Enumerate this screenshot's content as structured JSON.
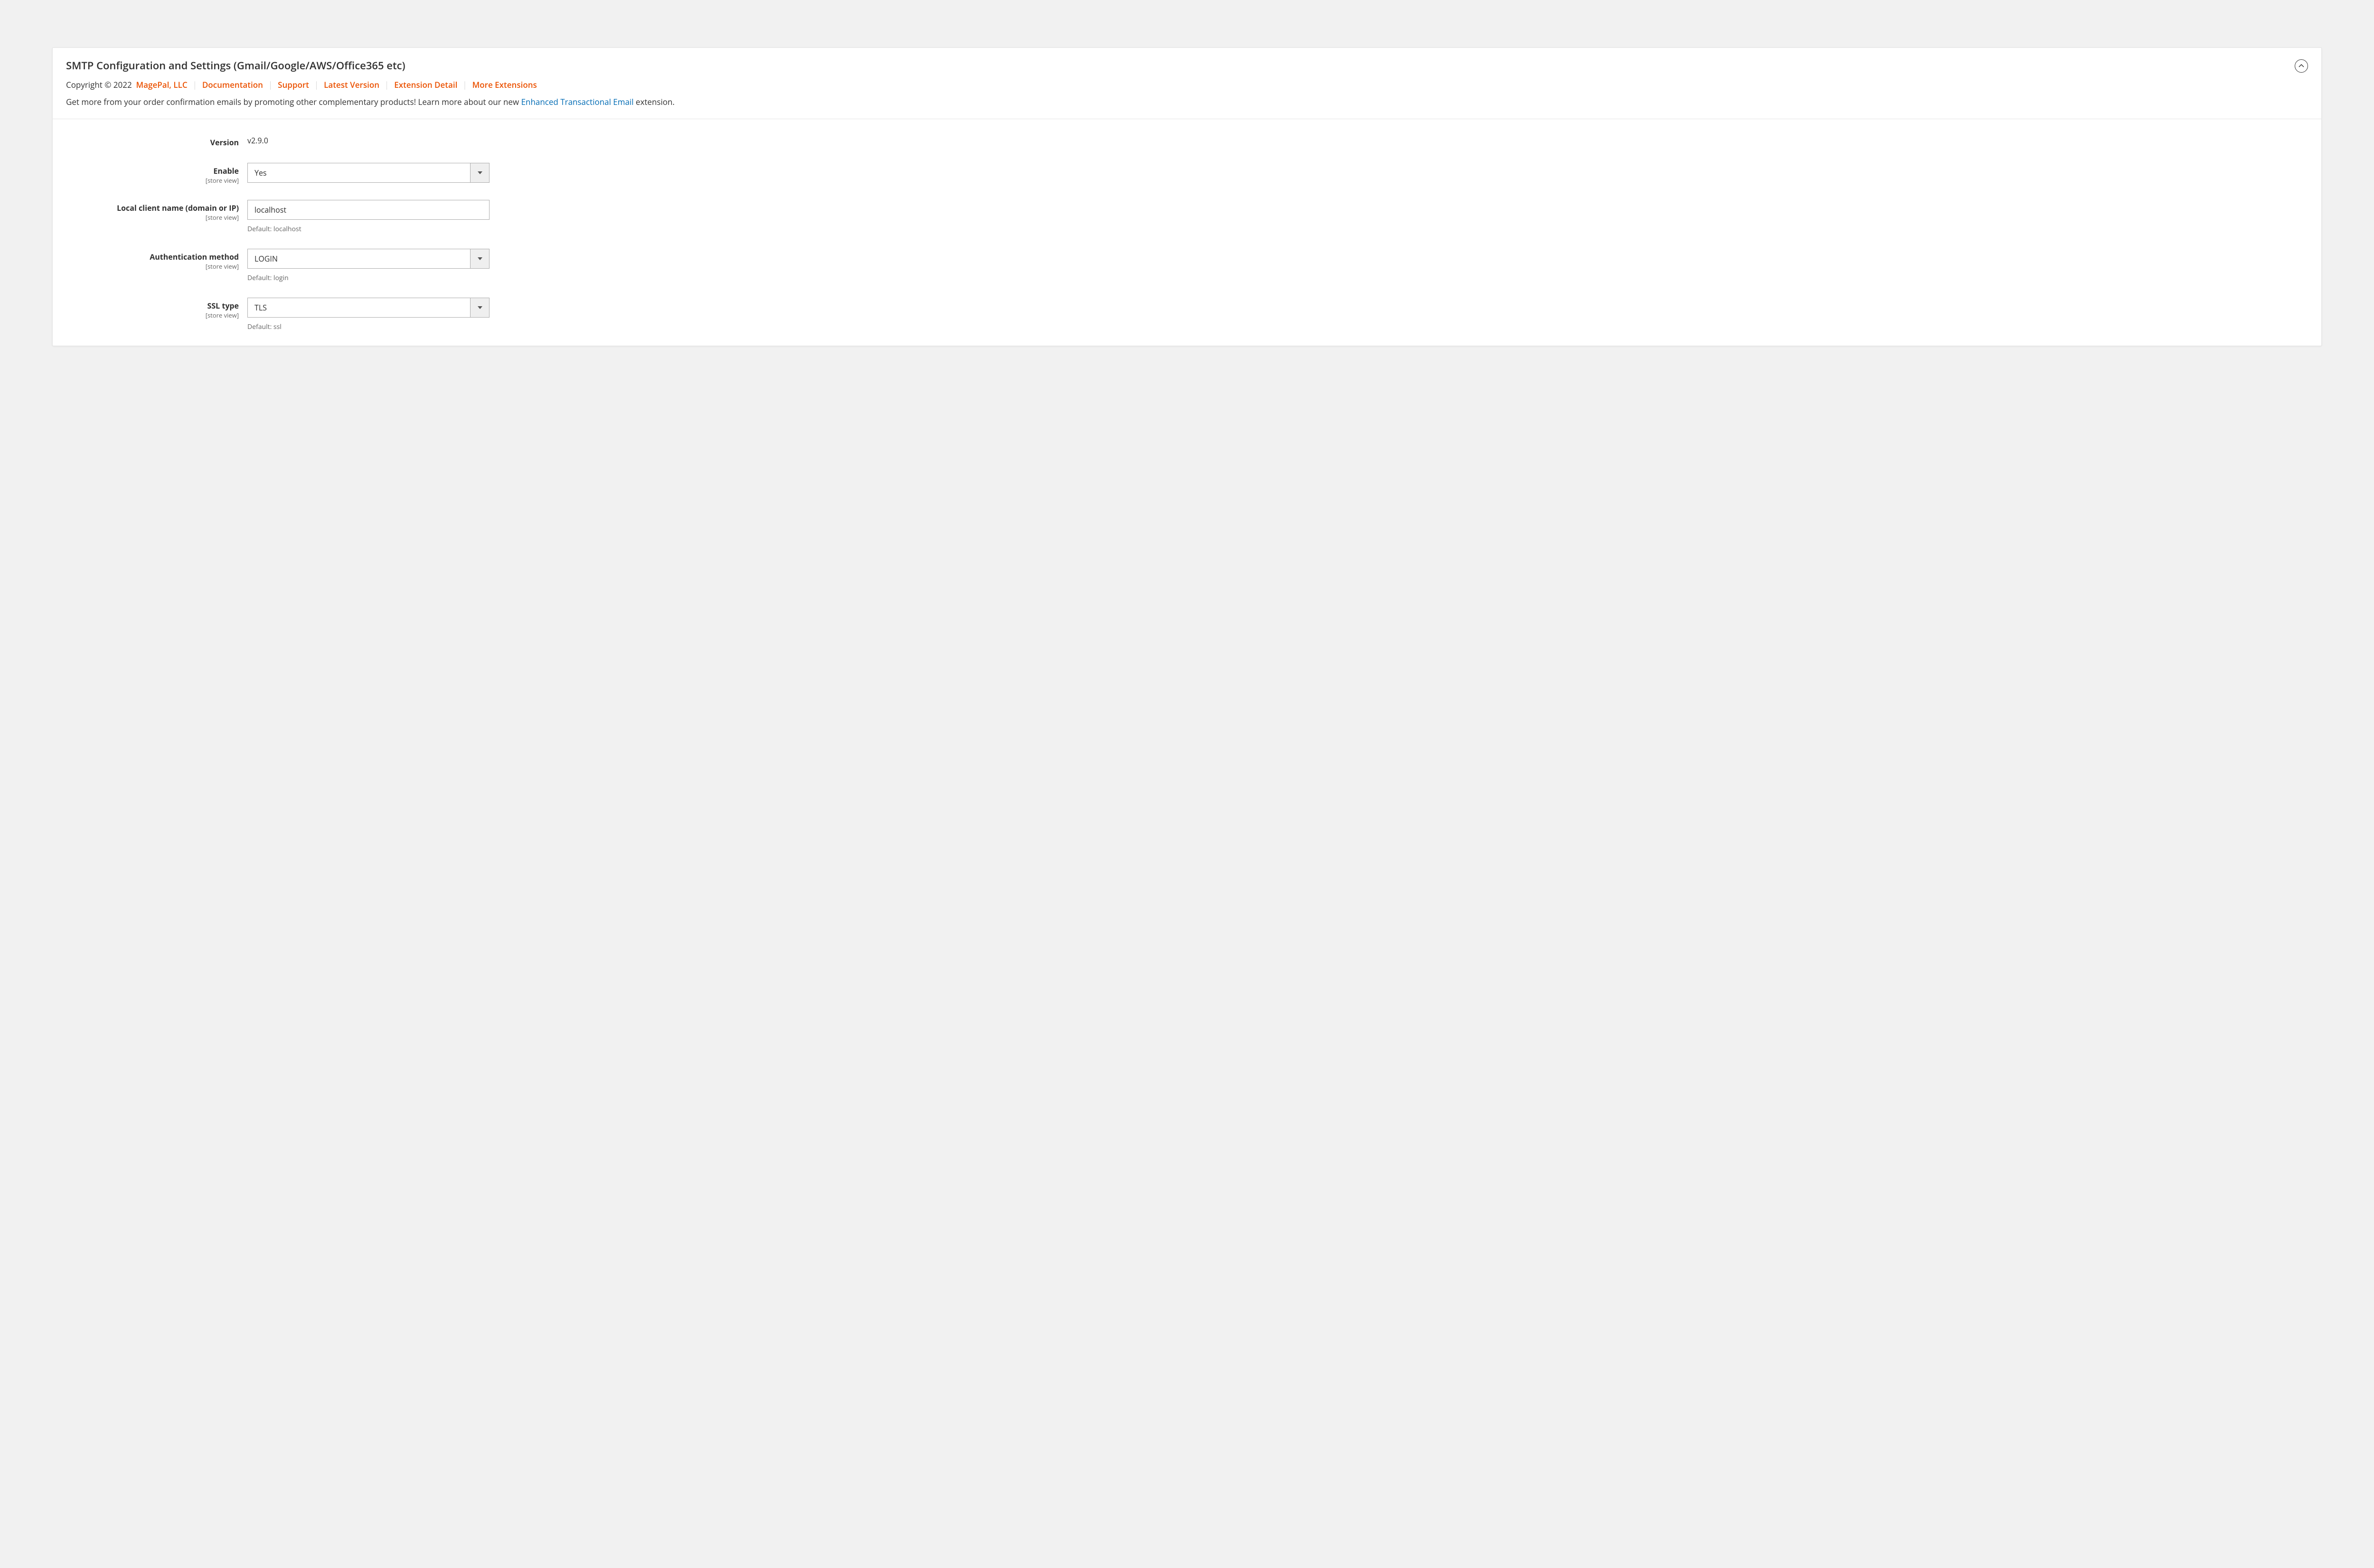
{
  "header": {
    "title": "SMTP Configuration and Settings (Gmail/Google/AWS/Office365 etc)",
    "copyright": "Copyright © 2022",
    "links": {
      "company": "MagePal, LLC",
      "documentation": "Documentation",
      "support": "Support",
      "latest_version": "Latest Version",
      "extension_detail": "Extension Detail",
      "more_extensions": "More Extensions"
    },
    "promo_text_before": "Get more from your order confirmation emails by promoting other complementary products! Learn more about our new ",
    "promo_link": "Enhanced Transactional Email",
    "promo_text_after": " extension."
  },
  "scope_label": "[store view]",
  "fields": {
    "version": {
      "label": "Version",
      "value": "v2.9.0"
    },
    "enable": {
      "label": "Enable",
      "value": "Yes"
    },
    "local_client": {
      "label": "Local client name (domain or IP)",
      "value": "localhost",
      "note": "Default: localhost"
    },
    "auth_method": {
      "label": "Authentication method",
      "value": "LOGIN",
      "note": "Default: login"
    },
    "ssl_type": {
      "label": "SSL type",
      "value": "TLS",
      "note": "Default: ssl"
    }
  }
}
